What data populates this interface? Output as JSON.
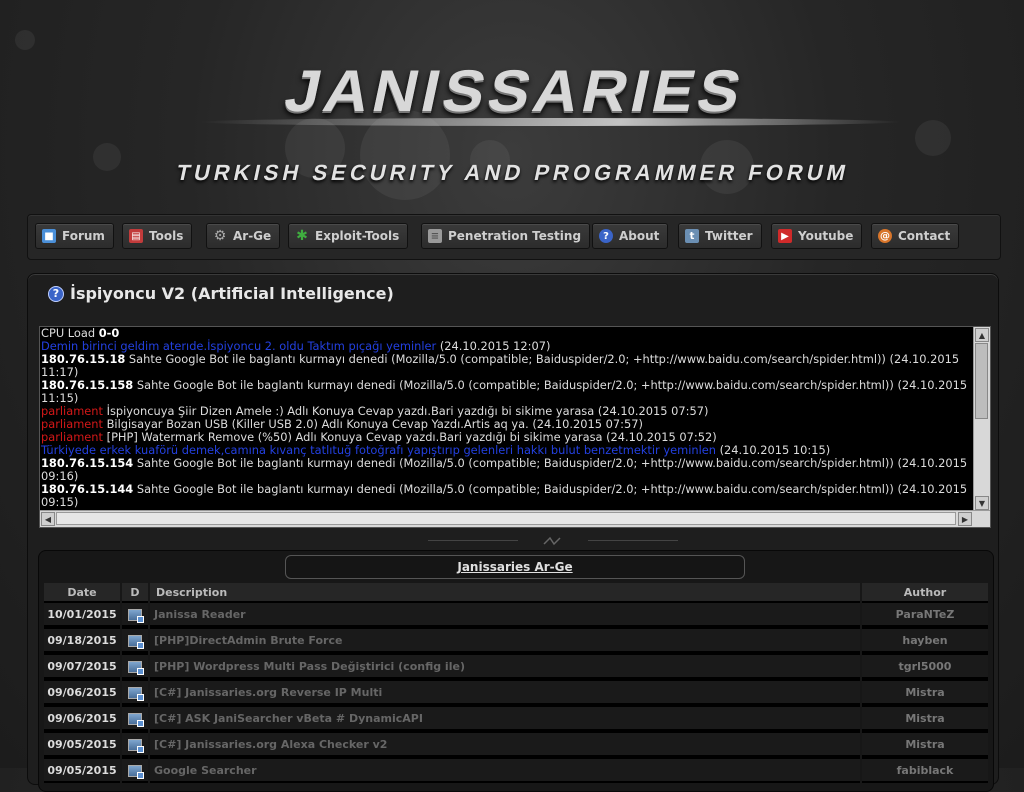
{
  "header": {
    "logo_title": "JANISSARIES",
    "logo_subtitle": "TURKISH SECURITY AND PROGRAMMER FORUM"
  },
  "nav": [
    {
      "label": "Forum",
      "icon": "forum-icon",
      "color": "#4a8fd8"
    },
    {
      "label": "Tools",
      "icon": "toolbox-icon",
      "color": "#c23b3b"
    },
    {
      "label": "Ar-Ge",
      "icon": "gear-icon",
      "color": "#8a8a8a"
    },
    {
      "label": "Exploit-Tools",
      "icon": "puzzle-icon",
      "color": "#3fae3f"
    },
    {
      "label": "Penetration Testing",
      "icon": "document-icon",
      "color": "#9a9a9a"
    },
    {
      "label": "About",
      "icon": "help-icon",
      "color": "#3a64c8"
    },
    {
      "label": "Twitter",
      "icon": "twitter-icon",
      "color": "#6b8fb3"
    },
    {
      "label": "Youtube",
      "icon": "youtube-icon",
      "color": "#d02a2a"
    },
    {
      "label": "Contact",
      "icon": "contact-icon",
      "color": "#d8752a"
    }
  ],
  "panel": {
    "title": "İspiyoncu V2 (Artificial Intelligence)"
  },
  "log": {
    "cpu_label": "CPU Load ",
    "cpu_value": "0-0",
    "lines": [
      {
        "a": "Demin birinci geldim aterıde.İspiyoncu 2. oldu Taktım pıçağı yeminler",
        "a_class": "c-blue",
        "b": " (24.10.2015 12:07)"
      },
      {
        "a": "180.76.15.18",
        "a_class": "b",
        "b": " Sahte Google Bot ile baglantı kurmayı denedi (Mozilla/5.0 (compatible; Baiduspider/2.0; +http://www.baidu.com/search/spider.html)) (24.10.2015 11:17)"
      },
      {
        "a": "180.76.15.158",
        "a_class": "b",
        "b": " Sahte Google Bot ile baglantı kurmayı denedi (Mozilla/5.0 (compatible; Baiduspider/2.0; +http://www.baidu.com/search/spider.html)) (24.10.2015 11:15)"
      },
      {
        "a": "parliament",
        "a_class": "c-red",
        "b": " İspiyoncuya Şiir Dizen Amele :) Adlı Konuya Cevap yazdı.Bari yazdığı bi sikime yarasa (24.10.2015 07:57)"
      },
      {
        "a": "parliament",
        "a_class": "c-red",
        "b": " Bilgisayar Bozan USB (Killer USB 2.0) Adlı Konuya Cevap Yazdı.Artis aq ya. (24.10.2015 07:57)"
      },
      {
        "a": "parliament",
        "a_class": "c-red",
        "b": " [PHP] Watermark Remove (%50) Adlı Konuya Cevap yazdı.Bari yazdığı bi sikime yarasa (24.10.2015 07:52)"
      },
      {
        "a": "Türkiyede erkek kuaförü demek,camına kıvanç tatlıtuğ fotoğrafı yapıştırıp gelenleri hakkı bulut benzetmektir yeminlen",
        "a_class": "c-blue",
        "b": " (24.10.2015 10:15)"
      },
      {
        "a": "180.76.15.154",
        "a_class": "b",
        "b": " Sahte Google Bot ile baglantı kurmayı denedi (Mozilla/5.0 (compatible; Baiduspider/2.0; +http://www.baidu.com/search/spider.html)) (24.10.2015 09:16)"
      },
      {
        "a": "180.76.15.144",
        "a_class": "b",
        "b": " Sahte Google Bot ile baglantı kurmayı denedi (Mozilla/5.0 (compatible; Baiduspider/2.0; +http://www.baidu.com/search/spider.html)) (24.10.2015 09:15)"
      }
    ]
  },
  "arge": {
    "title": "Janissaries Ar-Ge",
    "headers": {
      "date": "Date",
      "d": "D",
      "description": "Description",
      "author": "Author"
    },
    "rows": [
      {
        "date": "10/01/2015",
        "description": "Janissa Reader",
        "author": "ParaNTeZ"
      },
      {
        "date": "09/18/2015",
        "description": "[PHP]DirectAdmin Brute Force",
        "author": "hayben"
      },
      {
        "date": "09/07/2015",
        "description": "[PHP] Wordpress Multi Pass Değiştirici (config ile)",
        "author": "tgrl5000"
      },
      {
        "date": "09/06/2015",
        "description": "[C#] Janissaries.org Reverse IP Multi",
        "author": "Mistra"
      },
      {
        "date": "09/06/2015",
        "description": "[C#] ASK JaniSearcher vBeta # DynamicAPI",
        "author": "Mistra"
      },
      {
        "date": "09/05/2015",
        "description": "[C#] Janissaries.org Alexa Checker v2",
        "author": "Mistra"
      },
      {
        "date": "09/05/2015",
        "description": "Google Searcher",
        "author": "fabiblack"
      }
    ]
  }
}
